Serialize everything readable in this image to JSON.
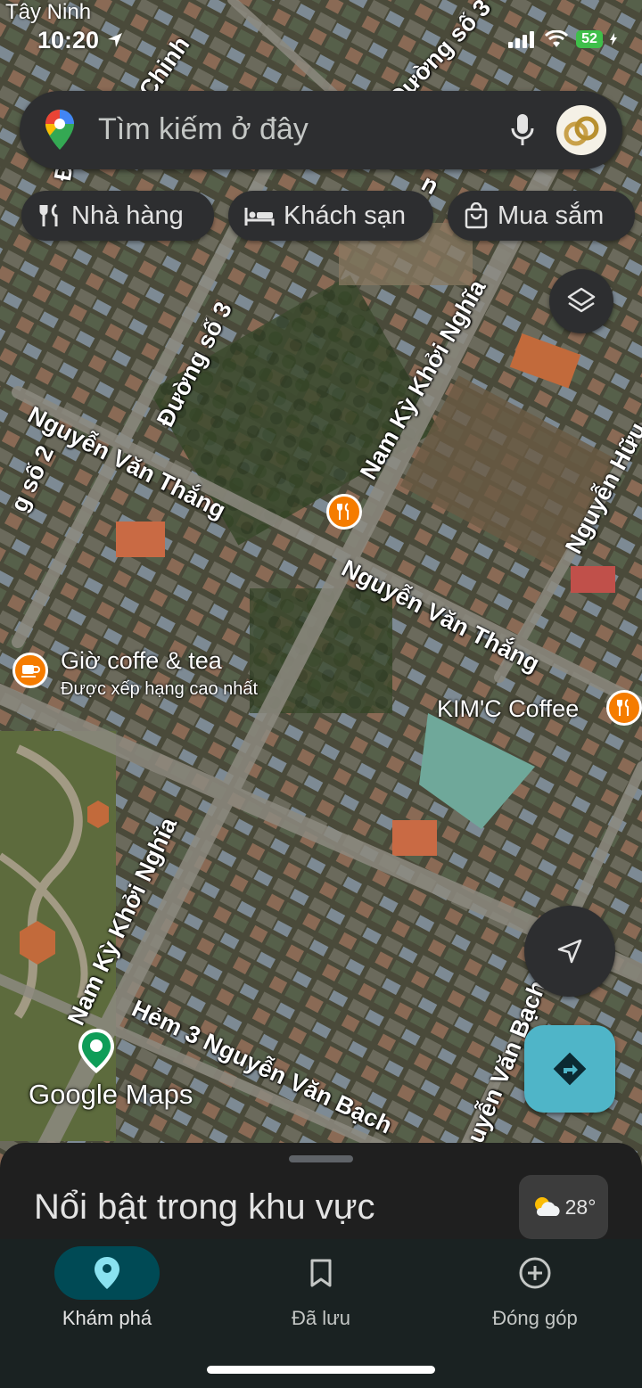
{
  "status_bar": {
    "location": "Tây Ninh",
    "time": "10:20",
    "battery": "52"
  },
  "search": {
    "placeholder": "Tìm kiếm ở đây"
  },
  "chips": [
    {
      "label": "Nhà hàng",
      "icon": "restaurant-icon"
    },
    {
      "label": "Khách sạn",
      "icon": "hotel-icon"
    },
    {
      "label": "Mua sắm",
      "icon": "shopping-bag-icon"
    }
  ],
  "map": {
    "street_labels": [
      "Chinh",
      "Đường số 3",
      "Đường số 3",
      "Nam Kỳ Khởi Nghĩa",
      "Nguyễn Văn Thắng",
      "Nguyễn Văn Thắng",
      "Nguyễn Hữu",
      "g số 2",
      "Nam Kỳ Khởi Nghĩa",
      "Hẻm 3 Nguyễn Văn Bạch",
      "uyễn Văn Bạch",
      "Đư",
      "n"
    ],
    "pois": [
      {
        "name": "Giờ coffe & tea",
        "subtitle": "Được xếp hạng cao nhất"
      },
      {
        "name": "KIM'C Coffee"
      }
    ],
    "watermark": "Google Maps"
  },
  "sheet": {
    "title": "Nổi bật trong khu vực",
    "temperature": "28°"
  },
  "nav": [
    {
      "label": "Khám phá",
      "icon": "location-pin-icon",
      "active": true
    },
    {
      "label": "Đã lưu",
      "icon": "bookmark-icon",
      "active": false
    },
    {
      "label": "Đóng góp",
      "icon": "add-circle-icon",
      "active": false
    }
  ],
  "colors": {
    "accent": "#8ab4f8",
    "nav_active_bg": "#004a55",
    "poi_orange": "#f57c00",
    "directions_teal": "#4fb5c8"
  }
}
